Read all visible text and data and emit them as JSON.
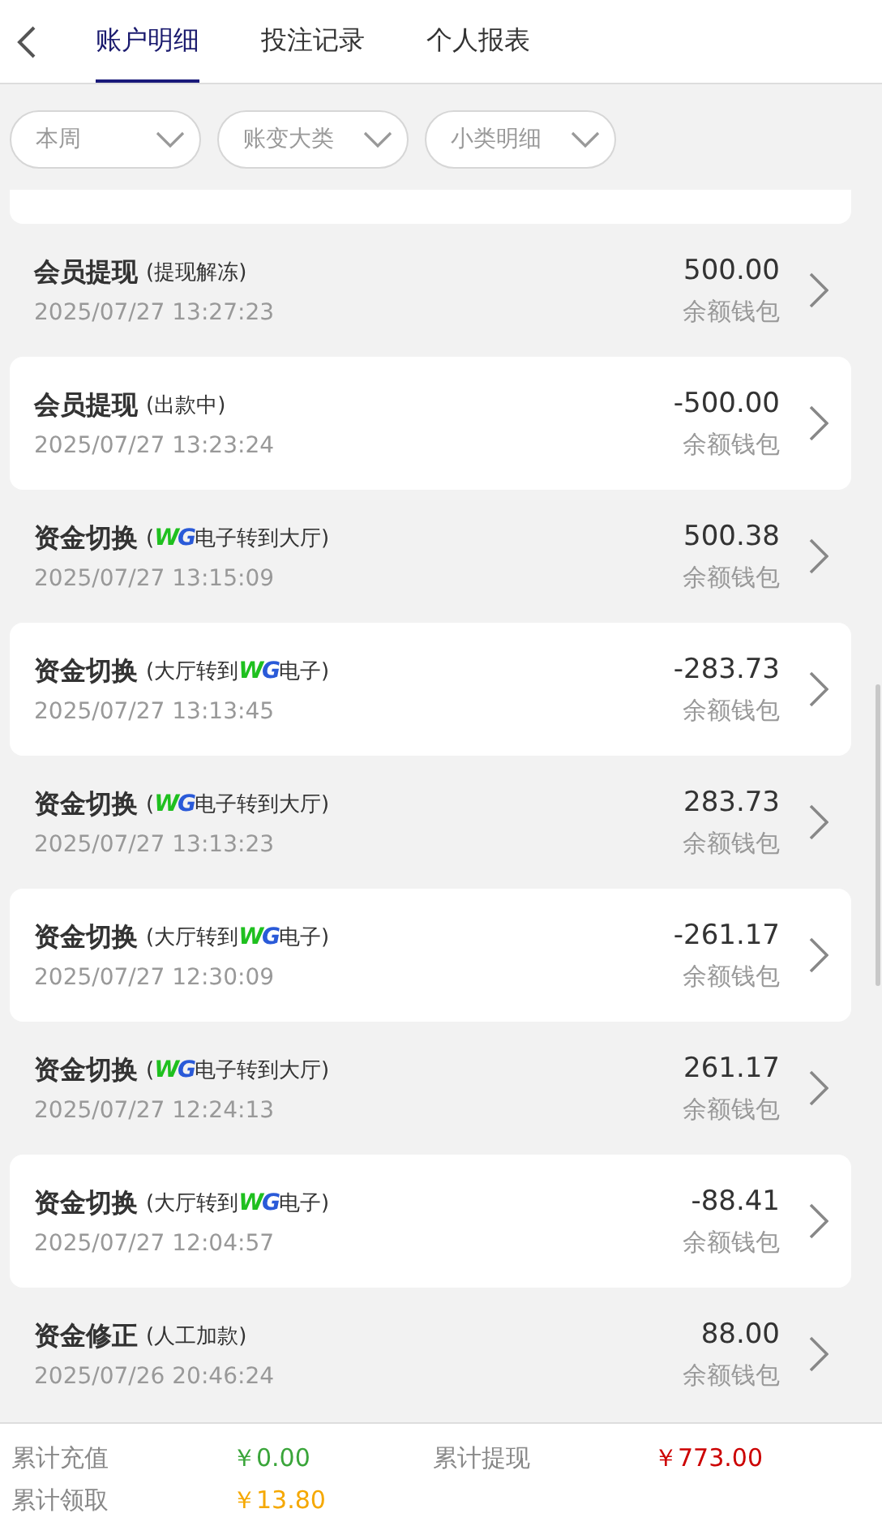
{
  "tabs": [
    {
      "label": "账户明细",
      "selected": true
    },
    {
      "label": "投注记录",
      "selected": false
    },
    {
      "label": "个人报表",
      "selected": false
    }
  ],
  "filters": [
    {
      "label": "本周"
    },
    {
      "label": "账变大类"
    },
    {
      "label": "小类明细"
    }
  ],
  "records": [
    {
      "title": "会员提现",
      "note": [
        {
          "kind": "text",
          "text": "(提现解冻)"
        }
      ],
      "time": "2025/07/27 13:27:23",
      "amount": "500.00",
      "wallet": "余额钱包"
    },
    {
      "title": "会员提现",
      "note": [
        {
          "kind": "text",
          "text": "(出款中)"
        }
      ],
      "time": "2025/07/27 13:23:24",
      "amount": "-500.00",
      "wallet": "余额钱包"
    },
    {
      "title": "资金切换",
      "note": [
        {
          "kind": "text",
          "text": "("
        },
        {
          "kind": "logo",
          "letters": [
            "W",
            "G"
          ]
        },
        {
          "kind": "text",
          "text": "电子转到大厅)"
        }
      ],
      "time": "2025/07/27 13:15:09",
      "amount": "500.38",
      "wallet": "余额钱包"
    },
    {
      "title": "资金切换",
      "note": [
        {
          "kind": "text",
          "text": "(大厅转到"
        },
        {
          "kind": "logo",
          "letters": [
            "W",
            "G"
          ]
        },
        {
          "kind": "text",
          "text": "电子)"
        }
      ],
      "time": "2025/07/27 13:13:45",
      "amount": "-283.73",
      "wallet": "余额钱包"
    },
    {
      "title": "资金切换",
      "note": [
        {
          "kind": "text",
          "text": "("
        },
        {
          "kind": "logo",
          "letters": [
            "W",
            "G"
          ]
        },
        {
          "kind": "text",
          "text": "电子转到大厅)"
        }
      ],
      "time": "2025/07/27 13:13:23",
      "amount": "283.73",
      "wallet": "余额钱包"
    },
    {
      "title": "资金切换",
      "note": [
        {
          "kind": "text",
          "text": "(大厅转到"
        },
        {
          "kind": "logo",
          "letters": [
            "W",
            "G"
          ]
        },
        {
          "kind": "text",
          "text": "电子)"
        }
      ],
      "time": "2025/07/27 12:30:09",
      "amount": "-261.17",
      "wallet": "余额钱包"
    },
    {
      "title": "资金切换",
      "note": [
        {
          "kind": "text",
          "text": "("
        },
        {
          "kind": "logo",
          "letters": [
            "W",
            "G"
          ]
        },
        {
          "kind": "text",
          "text": "电子转到大厅)"
        }
      ],
      "time": "2025/07/27 12:24:13",
      "amount": "261.17",
      "wallet": "余额钱包"
    },
    {
      "title": "资金切换",
      "note": [
        {
          "kind": "text",
          "text": "(大厅转到"
        },
        {
          "kind": "logo",
          "letters": [
            "W",
            "G"
          ]
        },
        {
          "kind": "text",
          "text": "电子)"
        }
      ],
      "time": "2025/07/27 12:04:57",
      "amount": "-88.41",
      "wallet": "余额钱包"
    },
    {
      "title": "资金修正",
      "note": [
        {
          "kind": "text",
          "text": "(人工加款)"
        }
      ],
      "time": "2025/07/26 20:46:24",
      "amount": "88.00",
      "wallet": "余额钱包"
    }
  ],
  "summary": [
    {
      "label": "累计充值",
      "value": "￥0.00",
      "color": "#3aa53a"
    },
    {
      "label": "累计提现",
      "value": "￥773.00",
      "color": "#cc0000"
    },
    {
      "label": "累计领取",
      "value": "￥13.80",
      "color": "#f5a800"
    }
  ]
}
